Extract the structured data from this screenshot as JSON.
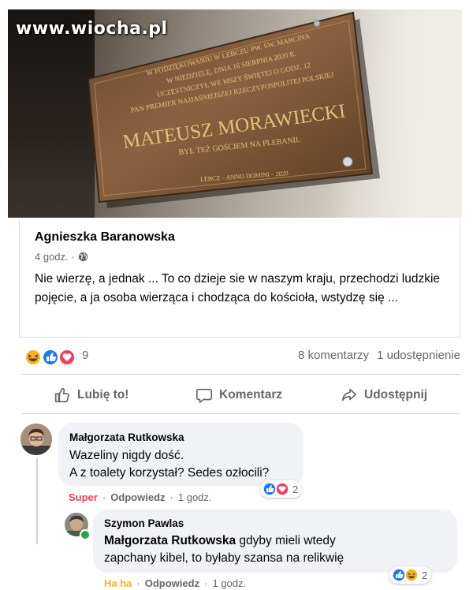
{
  "watermark": "www.wiocha.pl",
  "plaque": {
    "lines": [
      "W PODZIĘKOWANIU W LEBCZU PW. ŚW. MARCINA",
      "W NIEDZIELĘ, DNIA 16 SIERPNIA 2020 R.",
      "UCZESTNICZYŁ WE MSZY ŚWIĘTEJ O GODZ. 12",
      "PAN PREMIER NAJJAŚNIEJSZEJ RZECZYPOSPOLITEJ POLSKIEJ",
      "MATEUSZ MORAWIECKI",
      "BYŁ TEŻ GOŚCIEM NA PLEBANII.",
      "LEBCZ – ANNO DOMINI – 2020"
    ]
  },
  "post": {
    "author": "Agnieszka Baranowska",
    "time": "4 godz. ·",
    "privacy_icon": "globe-icon",
    "text": "Nie wierzę, a jednak ... To co dzieje sie w naszym kraju, przechodzi ludzkie pojęcie, a ja osoba wierząca i chodząca do kościoła, wstydzę się ..."
  },
  "reactions": {
    "icons": [
      "haha-icon",
      "like-icon",
      "love-icon"
    ],
    "count": "9",
    "comments": "8 komentarzy",
    "shares": "1 udostępnienie"
  },
  "actions": {
    "like": "Lubię to!",
    "comment": "Komentarz",
    "share": "Udostępnij"
  },
  "comments": [
    {
      "author": "Małgorzata Rutkowska",
      "text_line1": "Wazeliny nigdy dość.",
      "text_line2": "A z toalety korzystał? Sedes ozłocili?",
      "reaction_label": "Super",
      "reply": "Odpowiedz",
      "time": "1 godz.",
      "reaction_count": "2",
      "reaction_icons": [
        "like-icon",
        "love-icon"
      ],
      "reaction_color": "#f33e58"
    },
    {
      "author": "Szymon Pawlas",
      "mention": "Małgorzata Rutkowska",
      "text_rest": " gdyby mieli wtedy",
      "text_line2": "zapchany kibel, to byłaby szansa na relikwię",
      "reaction_label": "Ha ha",
      "reply": "Odpowiedz",
      "time": "1 godz.",
      "reaction_count": "2",
      "reaction_icons": [
        "like-icon",
        "haha-icon"
      ],
      "reaction_color": "#f7b125"
    }
  ],
  "colors": {
    "like": "#1877f2",
    "love": "#f33e58",
    "haha": "#f7b125",
    "secondary_text": "#65676b",
    "bubble": "#f0f2f5"
  }
}
